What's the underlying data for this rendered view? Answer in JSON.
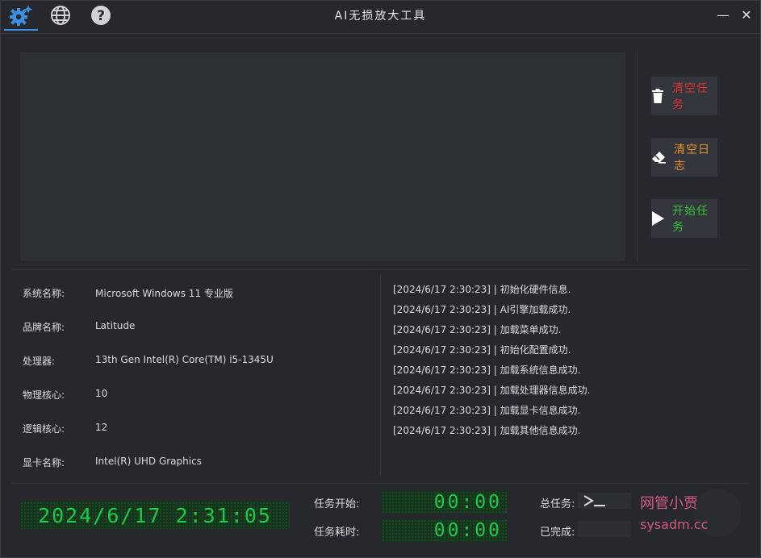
{
  "window": {
    "title": "AI无损放大工具"
  },
  "toolbar": {
    "icons": [
      "settings-sparkle-icon",
      "globe-icon",
      "help-icon"
    ],
    "minimize": "—",
    "close": "✕"
  },
  "actions": {
    "clear_tasks": "清空任务",
    "clear_log": "清空日志",
    "start_task": "开始任务",
    "colors": {
      "clear_tasks": "#e0312f",
      "clear_log": "#e8912a",
      "start_task": "#38c23a"
    }
  },
  "system_info": [
    {
      "label": "系统名称:",
      "value": "Microsoft Windows 11 专业版"
    },
    {
      "label": "品牌名称:",
      "value": "Latitude"
    },
    {
      "label": "处理器:",
      "value": "13th Gen Intel(R) Core(TM) i5-1345U"
    },
    {
      "label": "物理核心:",
      "value": "10"
    },
    {
      "label": "逻辑核心:",
      "value": "12"
    },
    {
      "label": "显卡名称:",
      "value": "Intel(R) UHD Graphics"
    }
  ],
  "log": [
    "[2024/6/17 2:30:23] | 初始化硬件信息.",
    "[2024/6/17 2:30:23] | AI引擎加载成功.",
    "[2024/6/17 2:30:23] | 加载菜单成功.",
    "[2024/6/17 2:30:23] | 初始化配置成功.",
    "[2024/6/17 2:30:23] | 加载系统信息成功.",
    "[2024/6/17 2:30:23] | 加载处理器信息成功.",
    "[2024/6/17 2:30:23] | 加载显卡信息成功.",
    "[2024/6/17 2:30:23] | 加载其他信息成功."
  ],
  "status": {
    "clock": "2024/6/17 2:31:05",
    "task_start_label": "任务开始:",
    "task_start_value": "00:00",
    "task_elapsed_label": "任务耗时:",
    "task_elapsed_value": "00:00",
    "total_label": "总任务:",
    "done_label": "已完成:",
    "led_color": "#1fc84a"
  },
  "watermark": {
    "line1": "网管小贾",
    "line2": "sysadm.cc"
  }
}
